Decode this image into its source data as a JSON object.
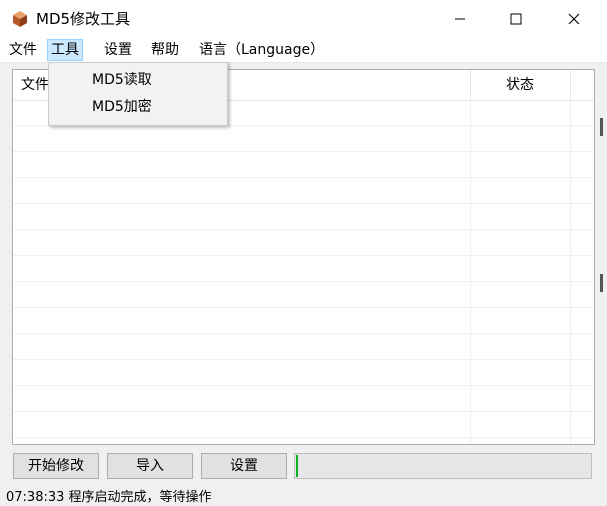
{
  "window": {
    "title": "MD5修改工具",
    "icon": "box-icon",
    "controls": [
      "minimize",
      "maximize",
      "close"
    ]
  },
  "menubar": {
    "items": [
      {
        "label": "文件"
      },
      {
        "label": "工具",
        "active": true
      },
      {
        "label": "设置"
      },
      {
        "label": "帮助"
      },
      {
        "label": "语言（Language）"
      }
    ]
  },
  "tools_menu": {
    "items": [
      {
        "label": "MD5读取"
      },
      {
        "label": "MD5加密"
      }
    ]
  },
  "file_list": {
    "columns": [
      "文件",
      "状态"
    ],
    "rows": []
  },
  "buttons": {
    "start": "开始修改",
    "import": "导入",
    "settings": "设置"
  },
  "progress": {
    "value_percent": 0,
    "color": "#06b025"
  },
  "status": {
    "text": "07:38:33 程序启动完成，等待操作"
  },
  "colors": {
    "menu_highlight": "#cce8ff",
    "window_bg": "#f0f0f0"
  }
}
